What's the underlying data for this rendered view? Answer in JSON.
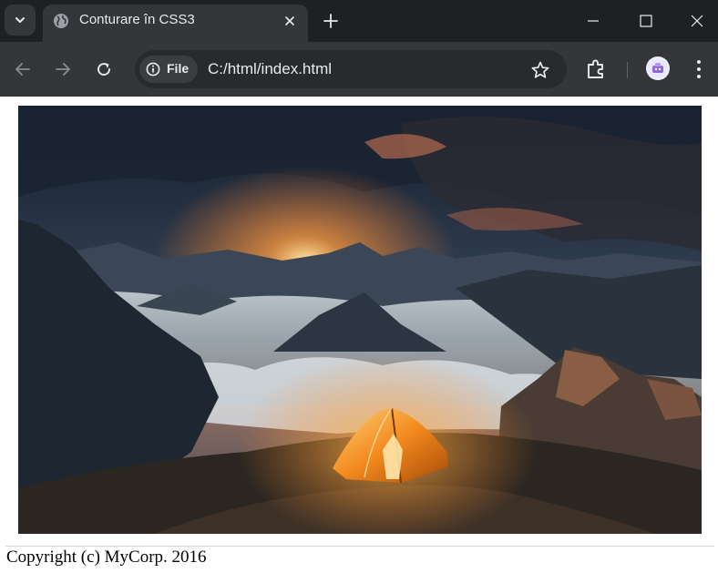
{
  "browser": {
    "tab": {
      "title": "Conturare în CSS3"
    },
    "address": {
      "chip_label": "File",
      "url": "C:/html/index.html"
    }
  },
  "icons": {
    "tab_search": "chevron-down-icon",
    "favicon": "globe-icon",
    "tab_close": "close-icon",
    "new_tab": "plus-icon",
    "minimize": "minimize-icon",
    "maximize": "maximize-icon",
    "close_window": "close-icon",
    "back": "arrow-left-icon",
    "forward": "arrow-right-icon",
    "reload": "reload-icon",
    "site_info": "info-icon",
    "bookmark": "star-icon",
    "extensions": "puzzle-icon",
    "profile": "avatar",
    "menu": "kebab-menu-icon"
  },
  "colors": {
    "chrome_dark": "#1f2023",
    "toolbar": "#35363a",
    "omnibox": "#282a2d",
    "text_light": "#e8eaed",
    "tent": "#f28a1e"
  },
  "page": {
    "image": {
      "subject": "tent-mountains-sunset"
    },
    "footer": {
      "text": "Copyright (c) MyCorp. 2016"
    }
  }
}
